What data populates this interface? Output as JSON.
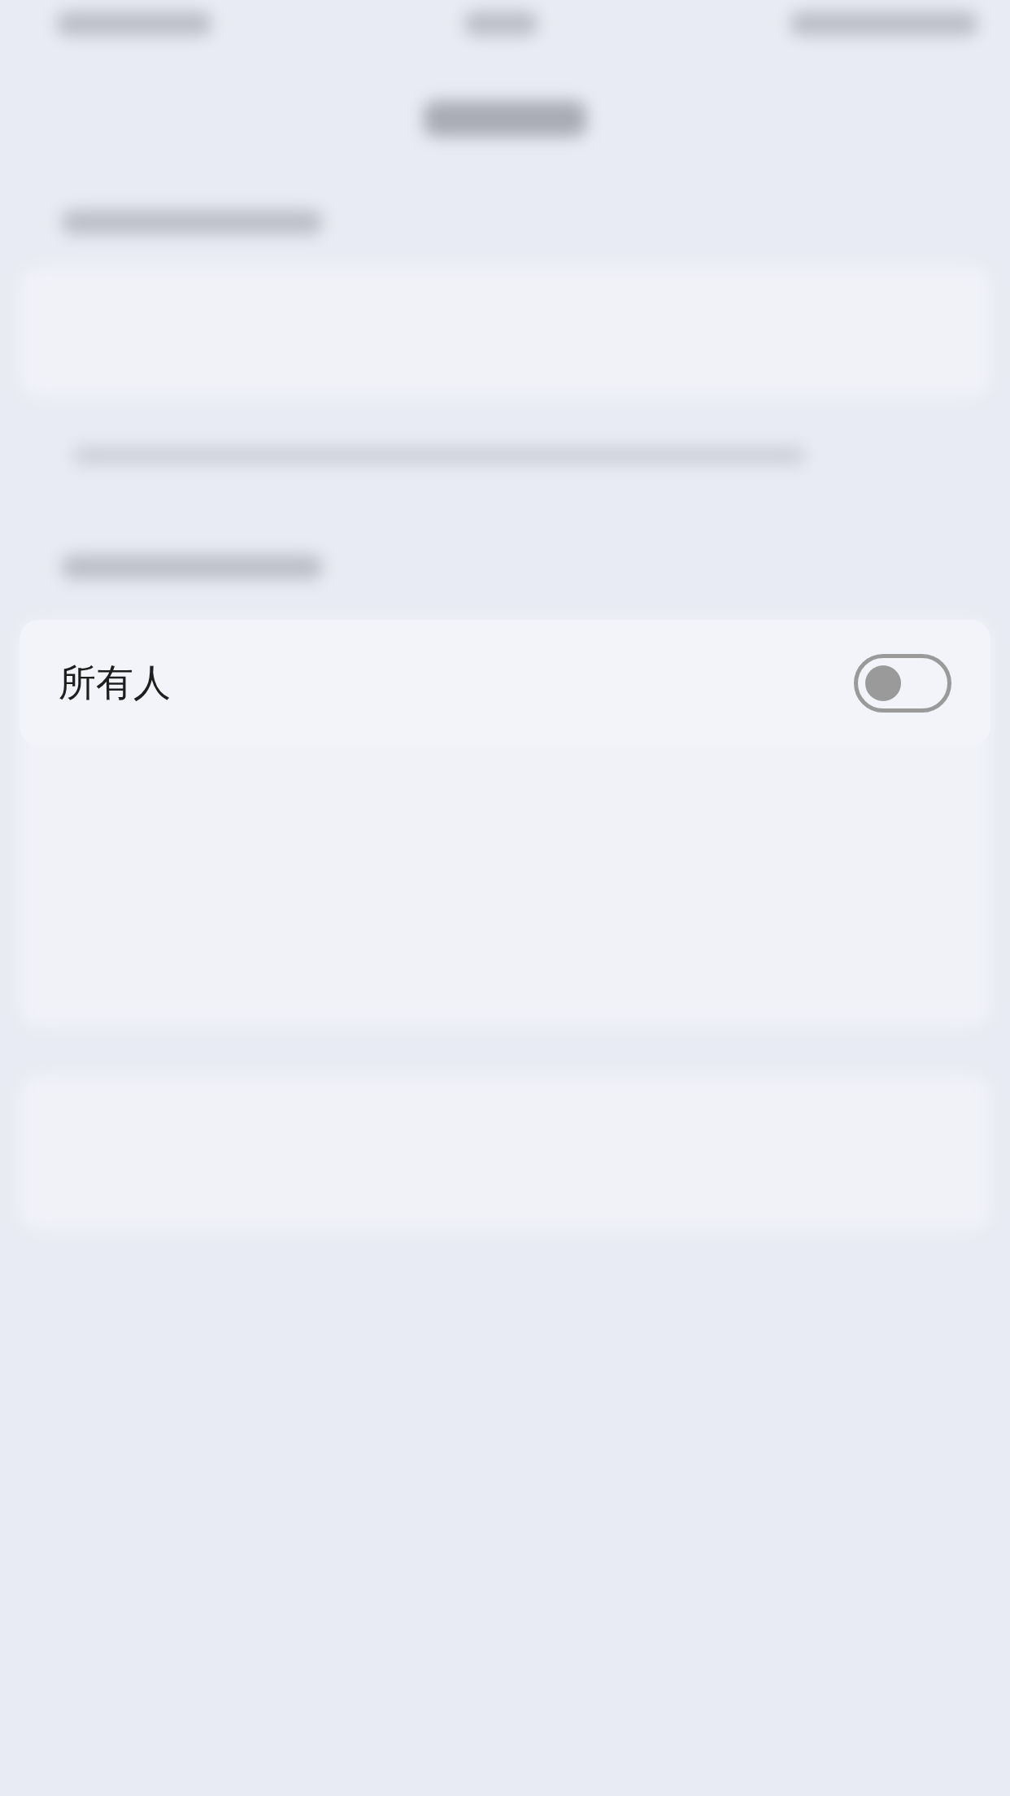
{
  "row": {
    "label": "所有人",
    "on": false
  }
}
